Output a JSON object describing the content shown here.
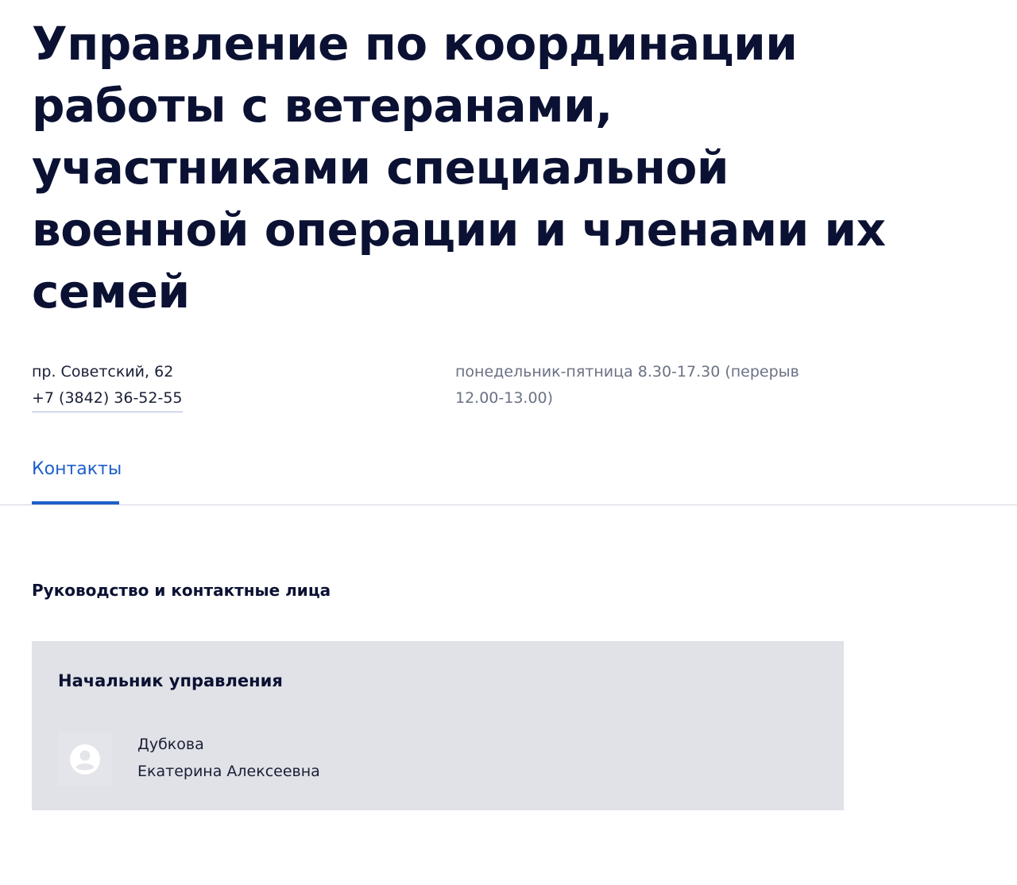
{
  "header": {
    "title_lines": [
      "Управление по координации",
      "работы с ветеранами,",
      "участниками специальной",
      "военной операции и членами их",
      "семей"
    ]
  },
  "contact_info": {
    "address": "пр. Советский, 62",
    "phone": "+7 (3842) 36-52-55",
    "schedule_lines": [
      "понедельник-пятница 8.30-17.30 (перерыв",
      "12.00-13.00)"
    ]
  },
  "tabs": [
    {
      "label": "Контакты",
      "active": true
    }
  ],
  "leadership": {
    "heading": "Руководство и контактные лица",
    "cards": [
      {
        "position": "Начальник управления",
        "avatar_icon": "user-avatar-icon",
        "name_lines": [
          "Дубкова",
          "Екатерина Алексеевна"
        ]
      }
    ]
  },
  "colors": {
    "text_primary": "#0b1133",
    "accent_blue": "#1e5fc9",
    "muted_text": "#6b7185",
    "card_background": "#e1e2e7"
  }
}
